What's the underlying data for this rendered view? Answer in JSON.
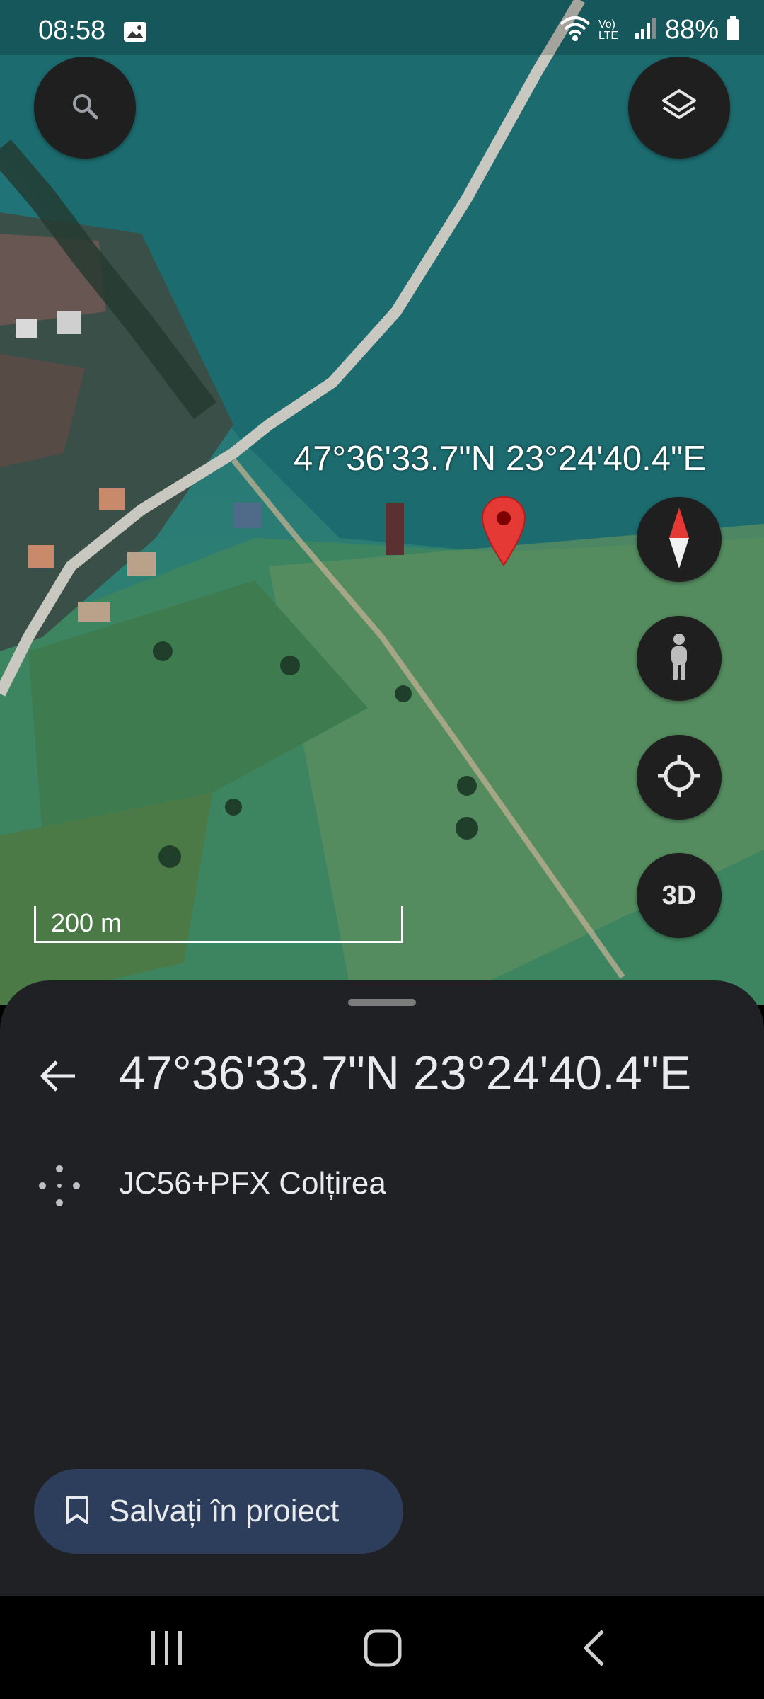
{
  "status_bar": {
    "time": "08:58",
    "network_label": "Vo) LTE",
    "battery": "88%",
    "icons": [
      "gallery-icon",
      "wifi-icon",
      "volte-icon",
      "signal-icon",
      "battery-icon"
    ]
  },
  "map": {
    "coordinates_label": "47°36'33.7\"N 23°24'40.4\"E",
    "scale_label": "200 m",
    "buttons": {
      "search": "search-icon",
      "layers": "layers-icon",
      "compass": "compass-icon",
      "street_view": "pegman-icon",
      "my_location": "my-location-icon",
      "three_d_label": "3D"
    },
    "pin_color": "#e53935"
  },
  "sheet": {
    "title": "47°36'33.7\"N 23°24'40.4\"E",
    "plus_code": "JC56+PFX Colțirea",
    "save_button_label": "Salvați în proiect"
  },
  "navigation_bar": {
    "icons": [
      "recent-apps-icon",
      "home-icon",
      "back-icon"
    ]
  },
  "colors": {
    "sheet_bg": "#202124",
    "button_bg": "#1f1f1f",
    "save_bg": "#2c3e5c"
  }
}
